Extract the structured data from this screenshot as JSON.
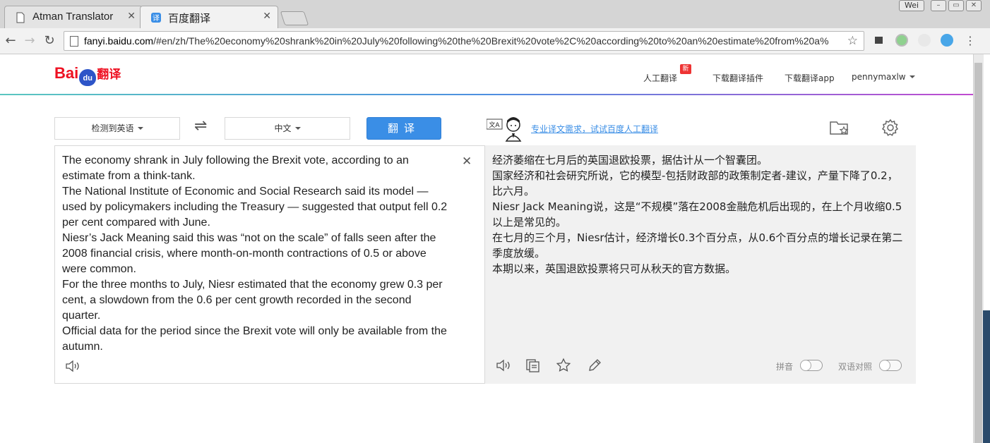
{
  "browser": {
    "tabs": [
      {
        "title": "Atman Translator",
        "close": "✕"
      },
      {
        "title": "百度翻译",
        "close": "✕"
      }
    ],
    "user_label": "Wei",
    "url_host": "fanyi.baidu.com",
    "url_rest": "/#en/zh/The%20economy%20shrank%20in%20July%20following%20the%20Brexit%20vote%2C%20according%20to%20an%20estimate%20from%20a%",
    "window_controls": [
      "–",
      "▭",
      "✕"
    ]
  },
  "header": {
    "logo_bai": "Bai",
    "logo_du": "du",
    "logo_fy": "翻译",
    "nav": [
      "人工翻译",
      "下载翻译插件",
      "下载翻译app"
    ],
    "badge": "新",
    "user": "pennymaxlw"
  },
  "controls": {
    "source_lang": "检测到英语",
    "target_lang": "中文",
    "swap_icon": "⇌",
    "translate_label": "翻译",
    "promo_link": "专业译文需求，试试百度人工翻译",
    "promo_badge": "文A"
  },
  "source": {
    "clear_icon": "✕",
    "lines": [
      "The economy shrank in July following the Brexit vote, according to an estimate from a think-tank.",
      "The National Institute of Economic and Social Research said its model — used by policymakers including the Treasury — suggested that output fell 0.2 per cent compared with June.",
      "Niesr’s Jack Meaning said this was “not on the scale” of falls seen after the 2008 financial crisis, where month-on-month contractions of 0.5 or above were common.",
      "For the three months to July, Niesr estimated that the economy grew 0.3 per cent, a slowdown from the 0.6 per cent growth recorded in the second quarter.",
      "Official data for the period since the Brexit vote will only be available from the autumn."
    ]
  },
  "target": {
    "lines": [
      "经济萎缩在七月后的英国退欧投票，据估计从一个智囊团。",
      "国家经济和社会研究所说，它的模型-包括财政部的政策制定者-建议，产量下降了0.2，比六月。",
      "Niesr Jack Meaning说，这是“不规模”落在2008金融危机后出现的，在上个月收缩0.5以上是常见的。",
      "在七月的三个月，Niesr估计，经济增长0.3个百分点，从0.6个百分点的增长记录在第二季度放缓。",
      "本期以来，英国退欧投票将只可从秋天的官方数据。"
    ],
    "toggle_pinyin": "拼音",
    "toggle_bilingual": "双语对照"
  }
}
